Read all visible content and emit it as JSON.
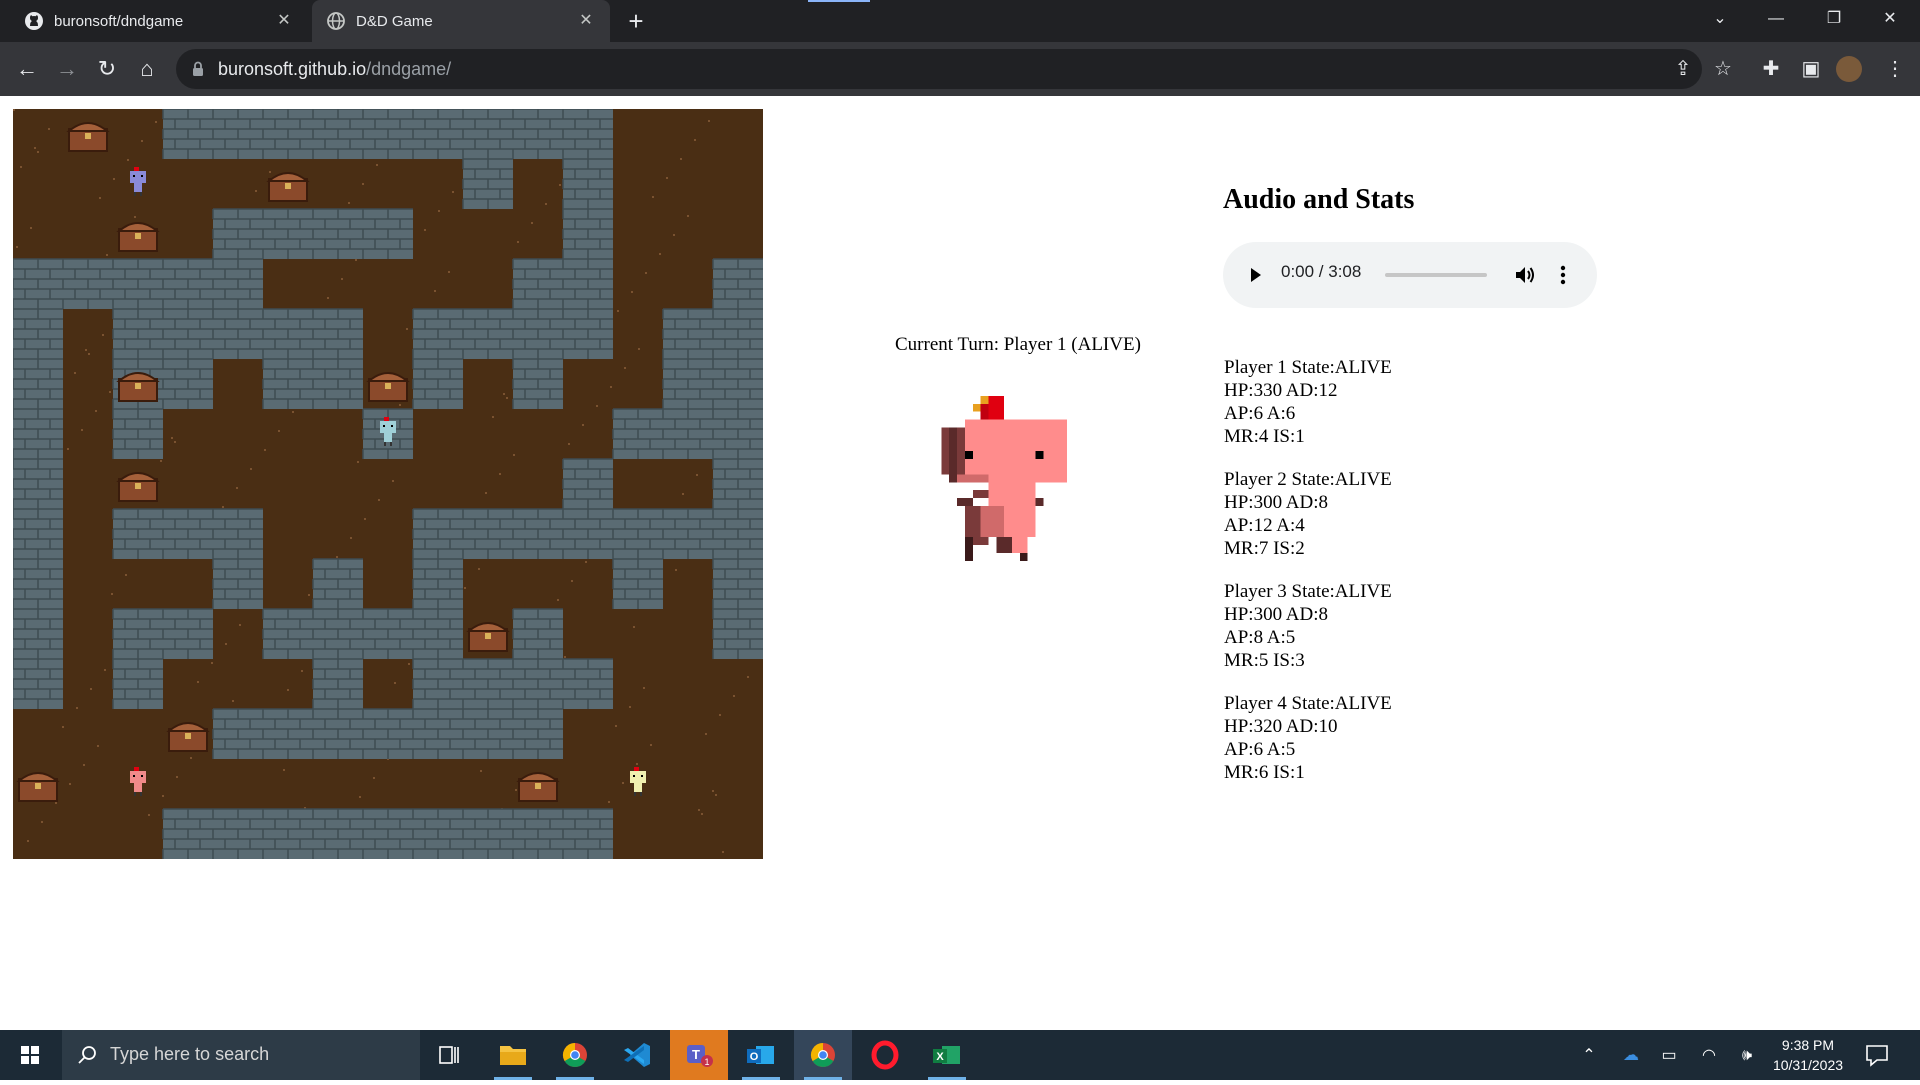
{
  "browser": {
    "tabs": [
      {
        "title": "buronsoft/dndgame",
        "favicon": "github-icon",
        "active": false
      },
      {
        "title": "D&D Game",
        "favicon": "globe-icon",
        "active": true
      }
    ],
    "url_host": "buronsoft.github.io",
    "url_path": "/dndgame/"
  },
  "game": {
    "current_turn": "Current Turn: Player 1 (ALIVE)",
    "map": {
      "rows": [
        "...WWWWWWWWW...",
        ".........W.W...",
        "....WWWW...W...",
        "WWWWW.....WW..W",
        "W.WWWWW.WWWW.WW",
        "W.WW.WW.W.W..WW",
        "W.W....W....WWW",
        "W..........W..W",
        "W.WWW...WWWWWWW",
        "W...W.W.W...W.W",
        "W.WW.WWWW.W...W",
        "W.W...W.WWWW...",
        "....WWWWWWW....",
        "...............",
        "...WWWWWWWWW..."
      ],
      "chests": [
        [
          1,
          0
        ],
        [
          5,
          1
        ],
        [
          2,
          2
        ],
        [
          2,
          5
        ],
        [
          7,
          5
        ],
        [
          2,
          7
        ],
        [
          9,
          10
        ],
        [
          3,
          12
        ],
        [
          0,
          13
        ],
        [
          10,
          13
        ]
      ],
      "players": [
        {
          "col": 2,
          "row": 1,
          "color": "#8a8ad8"
        },
        {
          "col": 7,
          "row": 6,
          "color": "#9fd0d8"
        },
        {
          "col": 2,
          "row": 13,
          "color": "#f08a8a"
        },
        {
          "col": 12,
          "row": 13,
          "color": "#f0f0b0"
        }
      ]
    }
  },
  "stats": {
    "heading": "Audio and Stats",
    "audio_time": "0:00 / 3:08",
    "players": [
      {
        "line1": "Player 1 State:ALIVE",
        "line2": "HP:330 AD:12",
        "line3": "AP:6 A:6",
        "line4": "MR:4 IS:1"
      },
      {
        "line1": "Player 2 State:ALIVE",
        "line2": "HP:300 AD:8",
        "line3": "AP:12 A:4",
        "line4": "MR:7 IS:2"
      },
      {
        "line1": "Player 3 State:ALIVE",
        "line2": "HP:300 AD:8",
        "line3": "AP:8 A:5",
        "line4": "MR:5 IS:3"
      },
      {
        "line1": "Player 4 State:ALIVE",
        "line2": "HP:320 AD:10",
        "line3": "AP:6 A:5",
        "line4": "MR:6 IS:1"
      }
    ]
  },
  "taskbar": {
    "search_placeholder": "Type here to search",
    "time": "9:38 PM",
    "date": "10/31/2023",
    "apps": [
      "task-view-icon",
      "file-explorer-icon",
      "chrome-icon",
      "vscode-icon",
      "teams-icon",
      "outlook-icon",
      "chrome-icon",
      "opera-icon",
      "excel-icon"
    ]
  },
  "colors": {
    "dirt": "#4a2e14",
    "wall": "#5a6b73",
    "chest": "#8b4a2b"
  }
}
